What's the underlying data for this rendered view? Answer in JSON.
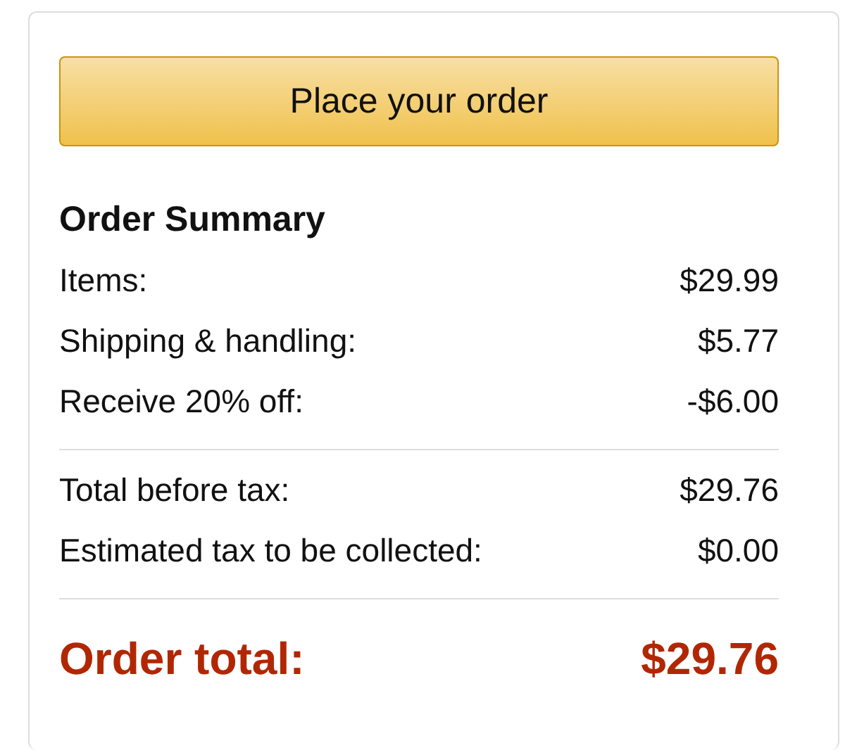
{
  "button": {
    "label": "Place your order"
  },
  "summary": {
    "title": "Order Summary",
    "groups": [
      [
        {
          "label": "Items:",
          "value": "$29.99"
        },
        {
          "label": "Shipping & handling:",
          "value": "$5.77"
        },
        {
          "label": "Receive 20% off:",
          "value": "-$6.00"
        }
      ],
      [
        {
          "label": "Total before tax:",
          "value": "$29.76"
        },
        {
          "label": "Estimated tax to be collected:",
          "value": "$0.00"
        }
      ]
    ],
    "total": {
      "label": "Order total:",
      "value": "$29.76"
    }
  }
}
